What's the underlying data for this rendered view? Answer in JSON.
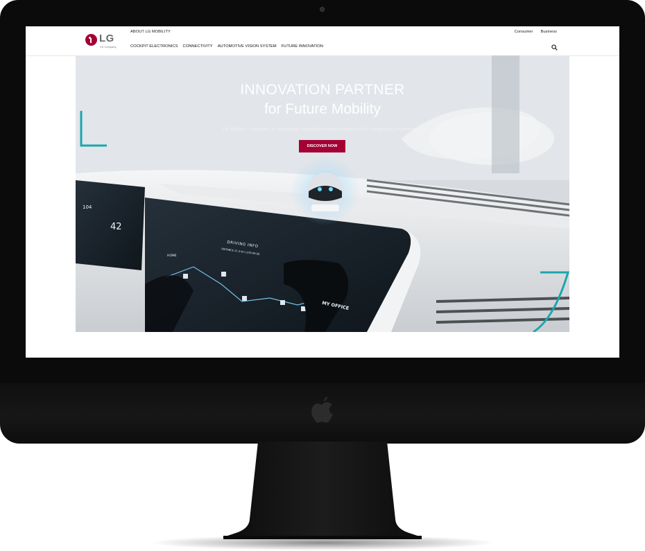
{
  "colors": {
    "accent": "#a50034",
    "teal": "#1aa6ad",
    "bezel": "#0b0b0b"
  },
  "icons": {
    "monitor_logo": "apple-icon",
    "search": "search-icon",
    "brand_mark": "lg-logo-mark"
  },
  "header": {
    "logo_text": "LG",
    "logo_sub": "VS Company",
    "top_link": "ABOUT LG MOBILITY",
    "nav": [
      "COCKPIT ELECTRONICS",
      "CONNECTIVITY",
      "AUTOMOTIVE VISION SYSTEM",
      "FUTURE INNOVATION"
    ],
    "utility": [
      "Consumer",
      "Business"
    ]
  },
  "hero": {
    "title_line1": "INNOVATION PARTNER",
    "title_line2": "for Future Mobility",
    "description": "LG Mobility is dedicated to developing competitive solutions based on LG's proprietary technologies.",
    "cta_label": "DISCOVER NOW",
    "display": {
      "speed": "104",
      "gauge": "42",
      "home_label": "HOME",
      "info_title": "DRIVING INFO",
      "info_sub": "DISTANCE 21.4 km  |  ETA 09:30",
      "destination": "MY OFFICE"
    }
  }
}
